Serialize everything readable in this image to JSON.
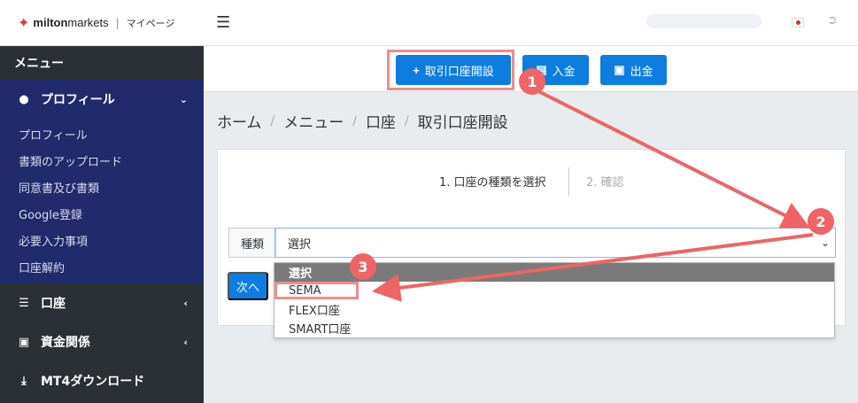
{
  "logo": {
    "brand_bold": "milton",
    "brand_light": "markets",
    "separator": "|",
    "subtitle": "マイページ"
  },
  "sidebar": {
    "header": "メニュー",
    "profile": {
      "label": "プロフィール",
      "icon": "user-icon",
      "items": [
        {
          "label": "プロフィール"
        },
        {
          "label": "書類のアップロード"
        },
        {
          "label": "同意書及び書類"
        },
        {
          "label": "Google登録"
        },
        {
          "label": "必要入力事項"
        },
        {
          "label": "口座解約"
        }
      ]
    },
    "account": {
      "label": "口座",
      "icon": "list-icon"
    },
    "funds": {
      "label": "資金関係",
      "icon": "wallet-icon"
    },
    "mt4": {
      "label": "MT4ダウンロード",
      "icon": "download-icon"
    }
  },
  "toolbar": {
    "open_account": "取引口座開設",
    "deposit": "入金",
    "withdraw": "出金"
  },
  "breadcrumb": [
    "ホーム",
    "メニュー",
    "口座",
    "取引口座開設"
  ],
  "steps": {
    "step1": "1. 口座の種類を選択",
    "step2": "2. 確認"
  },
  "form": {
    "type_label": "種類",
    "select_value": "選択",
    "next_label": "次へ",
    "options": [
      "選択",
      "SEMA",
      "FLEX口座",
      "SMART口座"
    ]
  },
  "annotations": {
    "badge1": "1",
    "badge2": "2",
    "badge3": "3"
  },
  "colors": {
    "primary": "#0d7de0",
    "sidebar": "#2b3035",
    "sidebar_active": "#212a6b",
    "annotation": "#ef6464"
  }
}
